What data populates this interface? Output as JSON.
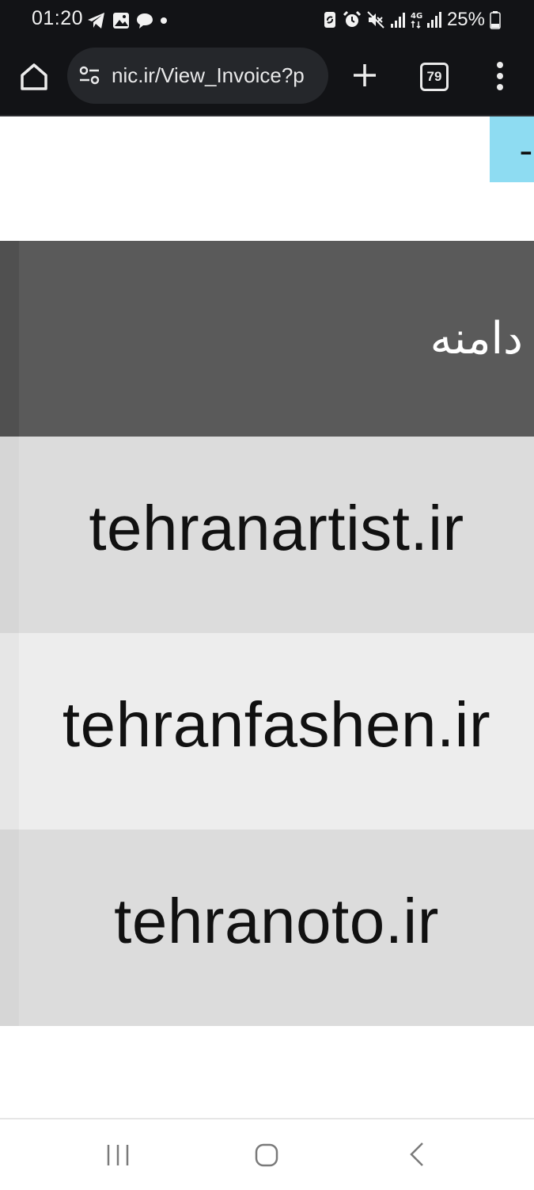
{
  "status_bar": {
    "time": "01:20",
    "notification_icons": [
      "telegram-icon",
      "gallery-icon",
      "chat-bubble-icon",
      "dot-icon"
    ],
    "system_icons": [
      "sync-icon",
      "alarm-icon",
      "mute-icon",
      "signal-icon",
      "4g-signal-icon"
    ],
    "battery": "25%"
  },
  "browser": {
    "url": "nic.ir/View_Invoice?p",
    "tab_count": "79",
    "icons": [
      "home-icon",
      "site-info-icon",
      "plus-icon",
      "tabs-icon",
      "more-vert-icon"
    ]
  },
  "table": {
    "header": "دامنه",
    "rows": [
      {
        "domain": "tehranartist.ir"
      },
      {
        "domain": "tehranfashen.ir"
      },
      {
        "domain": "tehranoto.ir"
      }
    ]
  },
  "colors": {
    "status_bar_bg": "#121316",
    "header_bg": "#5a5a5a",
    "row_odd": "#dcdcdc",
    "row_even": "#ededed",
    "accent_cyan": "#8edcf2"
  },
  "nav_bar": {
    "icons": [
      "recent-apps-icon",
      "home-icon",
      "back-icon"
    ]
  }
}
